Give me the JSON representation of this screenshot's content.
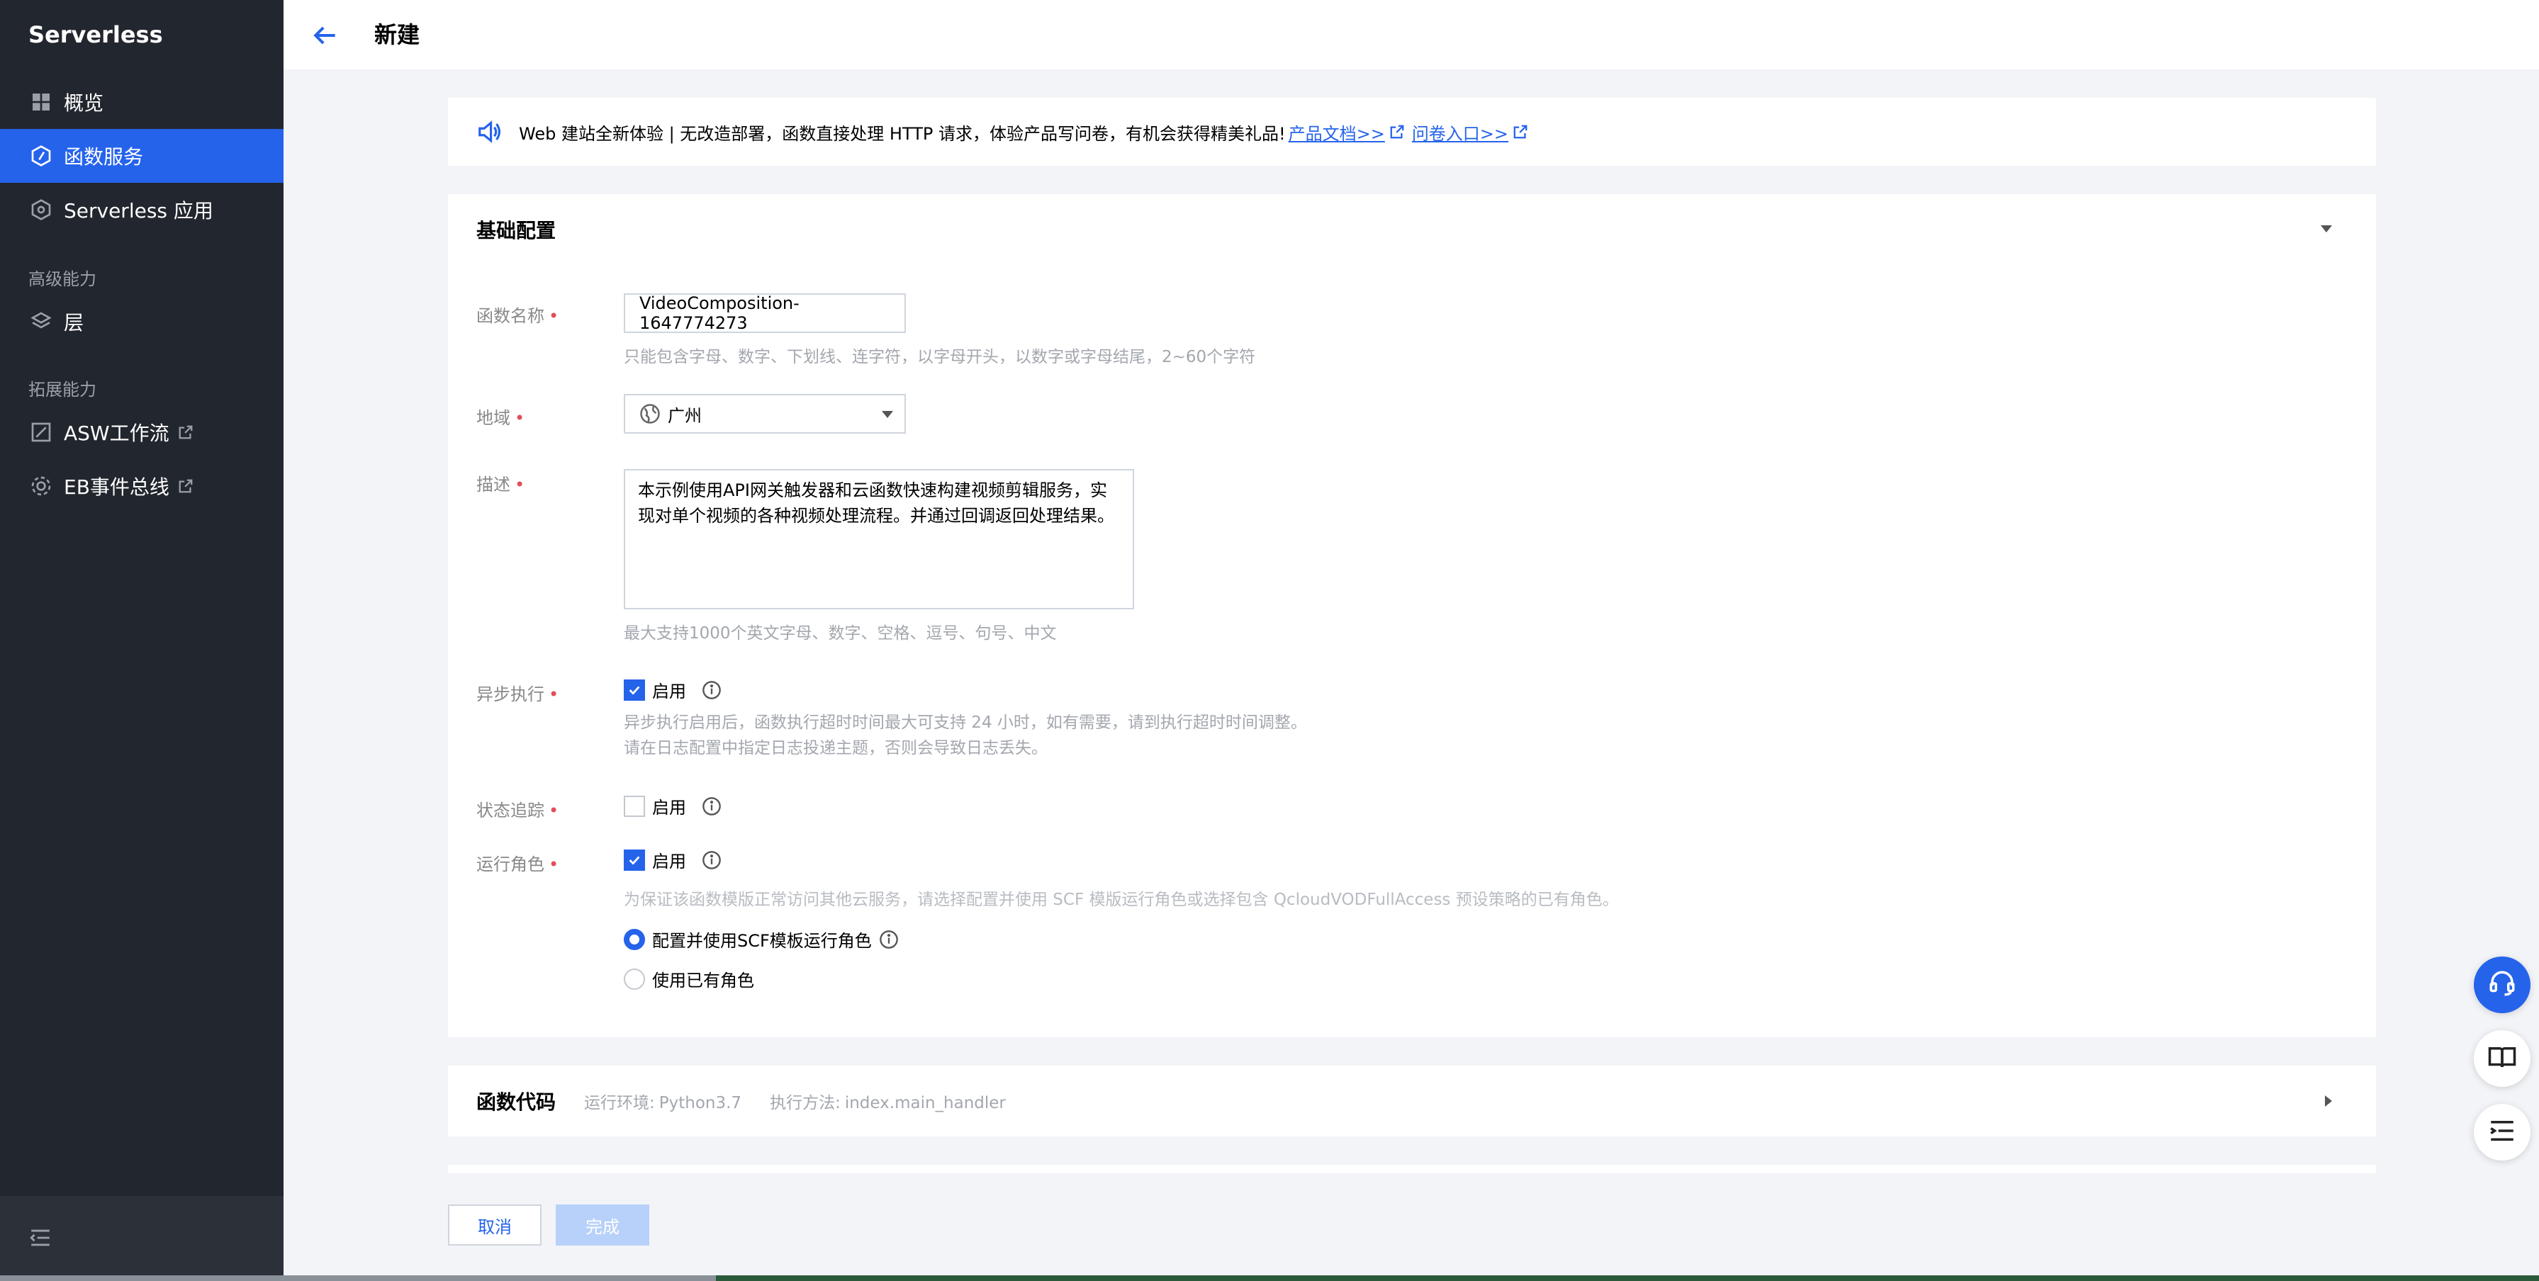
{
  "sidebar": {
    "brand": "Serverless",
    "items": [
      {
        "label": "概览"
      },
      {
        "label": "函数服务"
      },
      {
        "label": "Serverless 应用"
      }
    ],
    "group_advanced": "高级能力",
    "layer_label": "层",
    "group_extension": "拓展能力",
    "ext_items": [
      {
        "label": "ASW工作流"
      },
      {
        "label": "EB事件总线"
      }
    ]
  },
  "header": {
    "title": "新建"
  },
  "notice": {
    "text": "Web 建站全新体验 | 无改造部署，函数直接处理 HTTP 请求，体验产品写问卷，有机会获得精美礼品!",
    "link_docs": "产品文档>>",
    "link_survey": "问卷入口>>"
  },
  "basic": {
    "title": "基础配置",
    "name_label": "函数名称",
    "name_value": "VideoComposition-1647774273",
    "name_hint": "只能包含字母、数字、下划线、连字符，以字母开头，以数字或字母结尾，2~60个字符",
    "region_label": "地域",
    "region_value": "广州",
    "desc_label": "描述",
    "desc_value": "本示例使用API网关触发器和云函数快速构建视频剪辑服务，实现对单个视频的各种视频处理流程。并通过回调返回处理结果。",
    "desc_hint": "最大支持1000个英文字母、数字、空格、逗号、句号、中文",
    "async_label": "异步执行",
    "async_option": "启用",
    "async_checked": true,
    "async_hint1": "异步执行启用后，函数执行超时时间最大可支持 24 小时，如有需要，请到执行超时时间调整。",
    "async_hint2": "请在日志配置中指定日志投递主题，否则会导致日志丢失。",
    "trace_label": "状态追踪",
    "trace_option": "启用",
    "trace_checked": false,
    "role_label": "运行角色",
    "role_option": "启用",
    "role_checked": true,
    "role_hint": "为保证该函数模版正常访问其他云服务，请选择配置并使用 SCF 模版运行角色或选择包含 QcloudVODFullAccess 预设策略的已有角色。",
    "role_radio1": "配置并使用SCF模板运行角色",
    "role_radio2": "使用已有角色",
    "role_selected": 1
  },
  "code": {
    "title": "函数代码",
    "runtime_key": "运行环境:",
    "runtime_value": "Python3.7",
    "handler_key": "执行方法:",
    "handler_value": "index.main_handler"
  },
  "footer": {
    "cancel_label": "取消",
    "done_label": "完成"
  },
  "colors": {
    "sidebar_bg": "#22262e",
    "accent": "#2563eb",
    "required": "#e34d59",
    "done_disabled": "#b8d1fb"
  },
  "icons": [
    "grid-icon",
    "function-icon",
    "app-icon",
    "layers-icon",
    "workflow-icon",
    "eventbus-icon",
    "external-link-icon",
    "collapse-menu-icon",
    "back-arrow-icon",
    "speaker-icon",
    "globe-icon",
    "info-icon",
    "support-icon",
    "docs-icon",
    "list-icon"
  ]
}
